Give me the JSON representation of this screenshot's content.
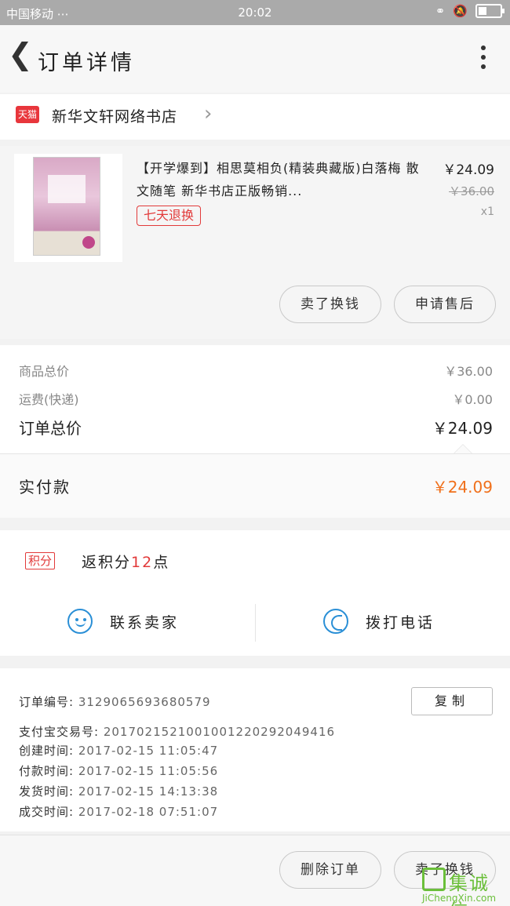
{
  "status_bar": {
    "carrier": "中国移动 ⋯",
    "time": "20:02"
  },
  "header": {
    "title": "订单详情"
  },
  "shop": {
    "tag": "天猫",
    "name": "新华文轩网络书店"
  },
  "product": {
    "title": "【开学爆到】相思莫相负(精装典藏版)白落梅 散文随笔 新华书店正版畅销...",
    "badge": "七天退换",
    "price": "￥24.09",
    "original_price": "￥36.00",
    "quantity": "x1",
    "buttons": {
      "resell": "卖了换钱",
      "after_sale": "申请售后"
    }
  },
  "summary": {
    "goods_total_label": "商品总价",
    "goods_total_value": "￥36.00",
    "shipping_label": "运费(快递)",
    "shipping_value": "￥0.00",
    "order_total_label": "订单总价",
    "order_total_value": "￥24.09",
    "paid_label": "实付款",
    "paid_value": "￥24.09"
  },
  "points": {
    "tag": "积分",
    "text_prefix": "返积分",
    "amount": "12",
    "text_suffix": "点",
    "contact_seller": "联系卖家",
    "call": "拨打电话"
  },
  "order_info": {
    "order_no_label": "订单编号:",
    "order_no": "3129065693680579",
    "copy_label": "复制",
    "alipay_label": "支付宝交易号:",
    "alipay_no": "2017021521001001220292049416",
    "created_label": "创建时间:",
    "created": "2017-02-15 11:05:47",
    "paid_label": "付款时间:",
    "paid": "2017-02-15 11:05:56",
    "shipped_label": "发货时间:",
    "shipped": "2017-02-15 14:13:38",
    "done_label": "成交时间:",
    "done": "2017-02-18 07:51:07"
  },
  "bottom": {
    "delete": "删除订单",
    "resell": "卖了换钱"
  },
  "watermark": {
    "cn": "集诚信",
    "en": "JiChengXin.com"
  },
  "colors": {
    "accent_red": "#e23a3a",
    "paid_orange": "#f0701b",
    "icon_blue": "#2a8fd6"
  }
}
